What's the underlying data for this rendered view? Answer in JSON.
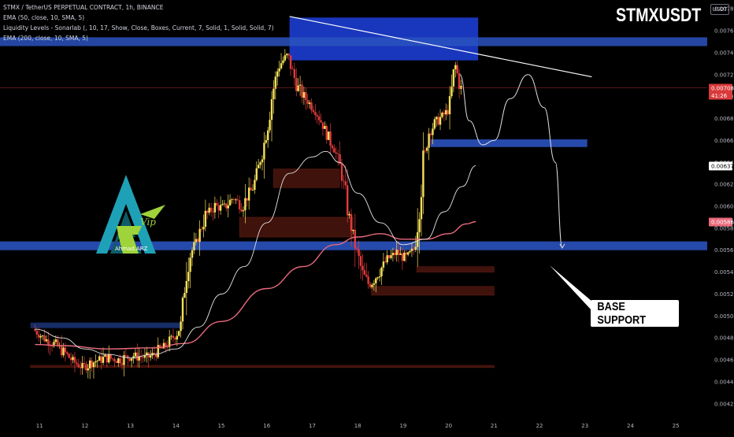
{
  "header": {
    "symbol_line": "STMX / TetherUS PERPETUAL CONTRACT, 1h, BINANCE",
    "indicator_1": "EMA (50, close, 10, SMA, 5)",
    "indicator_2": "Liquidity Levels - Sonarlab (, 10, 17, Show, Close, Boxes, Current, 7, Solid, 1, Solid, Solid, 7)",
    "indicator_3": "EMA (200, close, 10, SMA, 5)",
    "title": "STMXUSDT",
    "currency": "USDT"
  },
  "annotations": {
    "base_support": "BASE SUPPORT"
  },
  "logo": {
    "text": "Ahmad.ARZ",
    "vip": "Vip",
    "colors": {
      "teal": "#1ea1b6",
      "green": "#9fd33a",
      "dark": "#0e5b6a"
    }
  },
  "price_labels": {
    "last": "0.00708",
    "countdown": "41:26",
    "ema50": "0.00637",
    "ema200": "0.00586"
  },
  "colors": {
    "up": "#f5e15a",
    "down": "#e23b3b",
    "ema50": "#e6e6e6",
    "ema200": "#e86a7c",
    "zone": "#2a52be",
    "zone_bright": "#1d3fd6",
    "liquidity": "#5c1a12",
    "last_price": "#e23b3b"
  },
  "chart_data": {
    "type": "candlestick",
    "title": "STMXUSDT",
    "ylim": [
      0.00412,
      0.00788
    ],
    "y_ticks": [
      "0.00780",
      "0.00760",
      "0.00740",
      "0.00720",
      "0.00700",
      "0.00680",
      "0.00660",
      "0.00640",
      "0.00620",
      "0.00600",
      "0.00580",
      "0.00560",
      "0.00540",
      "0.00520",
      "0.00500",
      "0.00480",
      "0.00460",
      "0.00440",
      "0.00420"
    ],
    "x_ticks": [
      "11",
      "12",
      "13",
      "14",
      "15",
      "16",
      "17",
      "18",
      "19",
      "20",
      "21",
      "22",
      "23",
      "24",
      "25"
    ],
    "price_path": [
      [
        10.9,
        0.00488
      ],
      [
        11.2,
        0.00478
      ],
      [
        11.4,
        0.00474
      ],
      [
        11.6,
        0.00466
      ],
      [
        11.8,
        0.00458
      ],
      [
        12.0,
        0.00453
      ],
      [
        12.2,
        0.00458
      ],
      [
        12.5,
        0.00462
      ],
      [
        12.8,
        0.0046
      ],
      [
        13.1,
        0.00464
      ],
      [
        13.4,
        0.00462
      ],
      [
        13.6,
        0.00466
      ],
      [
        13.85,
        0.00474
      ],
      [
        14.05,
        0.00484
      ],
      [
        14.15,
        0.00492
      ],
      [
        14.3,
        0.00552
      ],
      [
        14.5,
        0.00568
      ],
      [
        14.7,
        0.00592
      ],
      [
        14.9,
        0.006
      ],
      [
        15.1,
        0.00598
      ],
      [
        15.3,
        0.00608
      ],
      [
        15.5,
        0.006
      ],
      [
        15.75,
        0.00618
      ],
      [
        16.0,
        0.0066
      ],
      [
        16.15,
        0.007
      ],
      [
        16.3,
        0.00728
      ],
      [
        16.5,
        0.00738
      ],
      [
        16.7,
        0.0071
      ],
      [
        16.9,
        0.00698
      ],
      [
        17.1,
        0.00688
      ],
      [
        17.3,
        0.00672
      ],
      [
        17.55,
        0.0065
      ],
      [
        17.7,
        0.00628
      ],
      [
        17.85,
        0.00592
      ],
      [
        18.0,
        0.00562
      ],
      [
        18.15,
        0.00538
      ],
      [
        18.3,
        0.00528
      ],
      [
        18.5,
        0.0054
      ],
      [
        18.7,
        0.00552
      ],
      [
        18.9,
        0.00558
      ],
      [
        19.1,
        0.00552
      ],
      [
        19.3,
        0.00562
      ],
      [
        19.45,
        0.00628
      ],
      [
        19.6,
        0.00668
      ],
      [
        19.75,
        0.00676
      ],
      [
        19.9,
        0.00682
      ],
      [
        20.05,
        0.00688
      ],
      [
        20.18,
        0.0073
      ],
      [
        20.3,
        0.00708
      ]
    ],
    "ema50_path": [
      [
        10.9,
        0.00488
      ],
      [
        11.5,
        0.0048
      ],
      [
        12.0,
        0.0047
      ],
      [
        12.5,
        0.00465
      ],
      [
        13.0,
        0.00462
      ],
      [
        13.5,
        0.00465
      ],
      [
        14.0,
        0.0047
      ],
      [
        14.5,
        0.0049
      ],
      [
        15.0,
        0.0052
      ],
      [
        15.5,
        0.00545
      ],
      [
        16.0,
        0.00585
      ],
      [
        16.5,
        0.0063
      ],
      [
        17.0,
        0.00645
      ],
      [
        17.3,
        0.0065
      ],
      [
        17.6,
        0.0064
      ],
      [
        18.0,
        0.00612
      ],
      [
        18.5,
        0.00585
      ],
      [
        19.0,
        0.00565
      ],
      [
        19.5,
        0.0057
      ],
      [
        19.9,
        0.00595
      ],
      [
        20.3,
        0.00618
      ],
      [
        20.6,
        0.00637
      ]
    ],
    "ema200_path": [
      [
        10.9,
        0.00474
      ],
      [
        11.5,
        0.00473
      ],
      [
        12.5,
        0.0047
      ],
      [
        13.5,
        0.00471
      ],
      [
        14.2,
        0.00475
      ],
      [
        15.0,
        0.00495
      ],
      [
        16.0,
        0.00525
      ],
      [
        16.8,
        0.00545
      ],
      [
        17.5,
        0.00565
      ],
      [
        18.0,
        0.00572
      ],
      [
        18.5,
        0.00575
      ],
      [
        19.0,
        0.0057
      ],
      [
        19.5,
        0.0057
      ],
      [
        20.0,
        0.00575
      ],
      [
        20.4,
        0.00584
      ],
      [
        20.6,
        0.00586
      ]
    ],
    "projection_path": [
      [
        20.25,
        0.0072
      ],
      [
        20.45,
        0.00678
      ],
      [
        20.75,
        0.00656
      ],
      [
        21.0,
        0.0066
      ],
      [
        21.35,
        0.00698
      ],
      [
        21.75,
        0.0072
      ],
      [
        22.1,
        0.0069
      ],
      [
        22.35,
        0.0064
      ],
      [
        22.5,
        0.00562
      ]
    ],
    "zones": [
      {
        "kind": "resistance",
        "x": [
          16.5,
          20.65
        ],
        "y": [
          0.00733,
          0.00772
        ]
      },
      {
        "kind": "resistance-band",
        "x": [
          10.0,
          26.0
        ],
        "y": [
          0.00746,
          0.00754
        ]
      },
      {
        "kind": "support",
        "x": [
          19.6,
          23.05
        ],
        "y": [
          0.00654,
          0.00661
        ]
      },
      {
        "kind": "base-support",
        "x": [
          10.0,
          26.0
        ],
        "y": [
          0.0056,
          0.00568
        ]
      },
      {
        "kind": "support-left",
        "x": [
          10.8,
          14.1
        ],
        "y": [
          0.00489,
          0.00494
        ]
      }
    ],
    "liquidity_boxes": [
      {
        "x": [
          16.15,
          17.6
        ],
        "y": [
          0.00617,
          0.00634
        ]
      },
      {
        "x": [
          15.4,
          17.9
        ],
        "y": [
          0.00572,
          0.0059
        ]
      },
      {
        "x": [
          19.3,
          21.0
        ],
        "y": [
          0.0054,
          0.00545
        ]
      },
      {
        "x": [
          18.3,
          21.0
        ],
        "y": [
          0.00519,
          0.00527
        ]
      },
      {
        "x": [
          10.8,
          21.0
        ],
        "y": [
          0.00453,
          0.00455
        ]
      }
    ],
    "trendline": [
      [
        16.5,
        0.00773
      ],
      [
        23.15,
        0.00718
      ]
    ],
    "last_price": 0.00708
  }
}
